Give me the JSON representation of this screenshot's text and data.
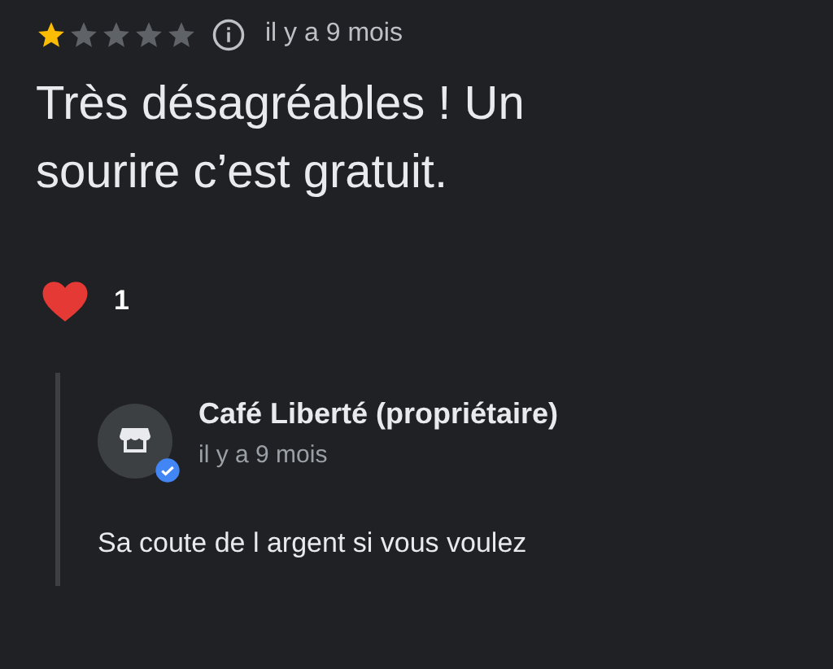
{
  "review": {
    "stars": 1,
    "time": "il y a 9 mois",
    "text": "Très désagréables ! Un sourire c’est gratuit.",
    "reaction_count": "1"
  },
  "reply": {
    "author": "Café Liberté (propriétaire)",
    "verified": true,
    "time": "il y a 9 mois",
    "text": "Sa coute de l argent si vous voulez"
  }
}
